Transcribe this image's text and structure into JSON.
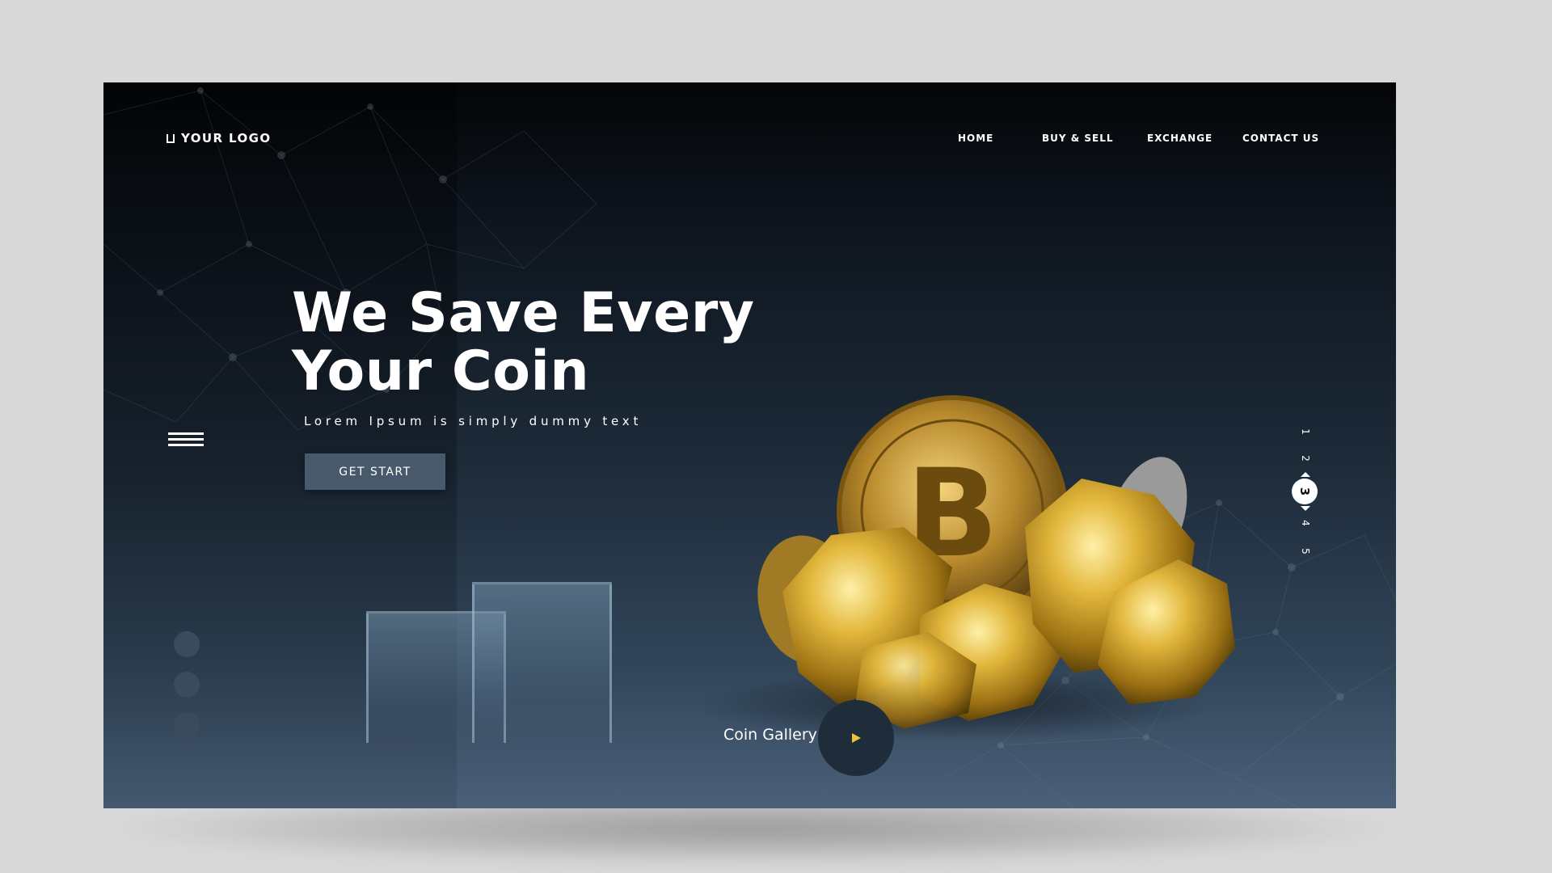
{
  "logo": {
    "text": "YOUR LOGO"
  },
  "nav": {
    "items": [
      "HOME",
      "BUY & SELL",
      "EXCHANGE",
      "CONTACT US"
    ]
  },
  "hero": {
    "title_line1": "We Save Every",
    "title_line2": "Your Coin",
    "subtitle": "Lorem Ipsum is simply dummy text",
    "cta_label": "GET START"
  },
  "gallery": {
    "label": "Coin Gallery"
  },
  "pager": {
    "pages": [
      "1",
      "2",
      "3",
      "4",
      "5"
    ],
    "active": "3"
  },
  "colors": {
    "accent_gold": "#e0b43a",
    "button": "#48596b",
    "play_arrow": "#f0c040"
  },
  "icons": [
    "menu-icon",
    "play-icon",
    "logo-mark-icon"
  ]
}
